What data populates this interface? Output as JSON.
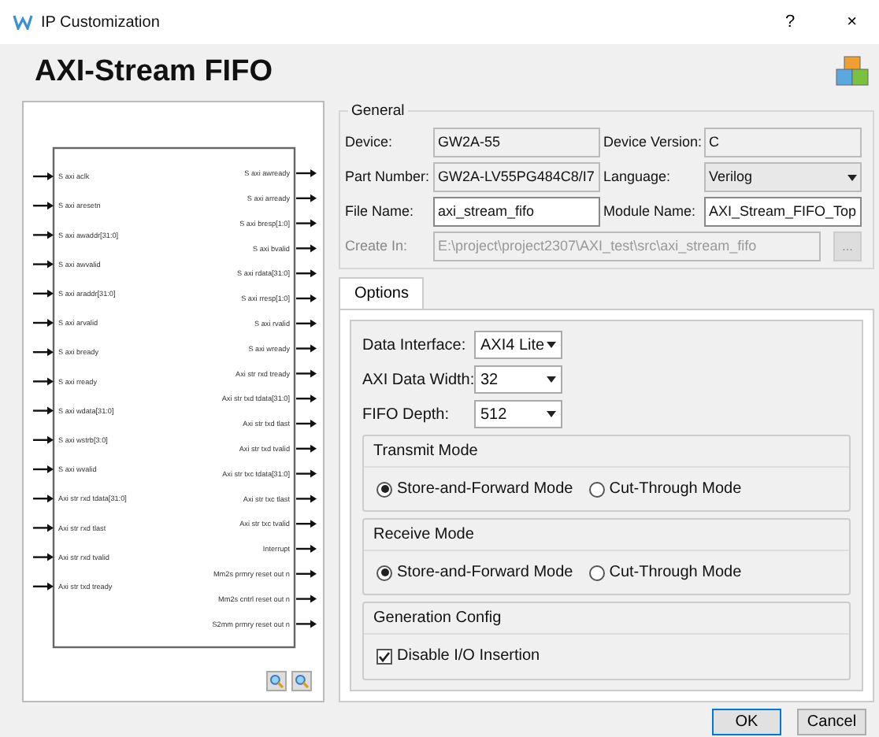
{
  "window": {
    "title": "IP Customization",
    "help": "?",
    "close": "×"
  },
  "header": {
    "title": "AXI-Stream FIFO"
  },
  "diagram": {
    "inputs": [
      "S axi aclk",
      "S axi aresetn",
      "S axi awaddr[31:0]",
      "S axi awvalid",
      "S axi araddr[31:0]",
      "S axi arvalid",
      "S axi bready",
      "S axi rready",
      "S axi wdata[31:0]",
      "S axi wstrb[3:0]",
      "S axi wvalid",
      "Axi str rxd tdata[31:0]",
      "Axi str rxd tlast",
      "Axi str rxd tvalid",
      "Axi str txd tready"
    ],
    "outputs": [
      "S axi awready",
      "S axi arready",
      "S axi bresp[1:0]",
      "S axi bvalid",
      "S axi rdata[31:0]",
      "S axi rresp[1:0]",
      "S axi rvalid",
      "S axi wready",
      "Axi str rxd tready",
      "Axi str txd tdata[31:0]",
      "Axi str txd tlast",
      "Axi str txd tvalid",
      "Axi str txc tdata[31:0]",
      "Axi str txc tlast",
      "Axi str txc tvalid",
      "Interrupt",
      "Mm2s prmry reset out n",
      "Mm2s cntrl reset out n",
      "S2mm prmry reset out n"
    ]
  },
  "general": {
    "legend": "General",
    "fields": [
      {
        "label": "Device:",
        "value": "GW2A-55",
        "kind": "readonly"
      },
      {
        "label": "Device Version:",
        "value": "C",
        "kind": "readonly"
      },
      {
        "label": "Part Number:",
        "value": "GW2A-LV55PG484C8/I7",
        "kind": "readonly"
      },
      {
        "label": "Language:",
        "value": "Verilog",
        "kind": "select"
      },
      {
        "label": "File Name:",
        "value": "axi_stream_fifo",
        "kind": "text"
      },
      {
        "label": "Module Name:",
        "value": "AXI_Stream_FIFO_Top",
        "kind": "text"
      },
      {
        "label": "Create In:",
        "value": "E:\\project\\project2307\\AXI_test\\src\\axi_stream_fifo",
        "kind": "path",
        "button": "..."
      }
    ]
  },
  "tabs": [
    {
      "label": "Options",
      "selected": true
    }
  ],
  "options": {
    "fields": [
      {
        "label": "Data Interface:",
        "value": "AXI4 Lite"
      },
      {
        "label": "AXI Data Width:",
        "value": "32"
      },
      {
        "label": "FIFO Depth:",
        "value": "512"
      }
    ],
    "groups": [
      {
        "title": "Transmit Mode",
        "kind": "radio",
        "options": [
          {
            "label": "Store-and-Forward Mode",
            "selected": true
          },
          {
            "label": "Cut-Through Mode",
            "selected": false
          }
        ]
      },
      {
        "title": "Receive Mode",
        "kind": "radio",
        "options": [
          {
            "label": "Store-and-Forward Mode",
            "selected": true
          },
          {
            "label": "Cut-Through Mode",
            "selected": false
          }
        ]
      },
      {
        "title": "Generation Config",
        "kind": "checkbox",
        "options": [
          {
            "label": "Disable I/O Insertion",
            "checked": true
          }
        ]
      }
    ]
  },
  "buttons": [
    "OK",
    "Cancel"
  ]
}
